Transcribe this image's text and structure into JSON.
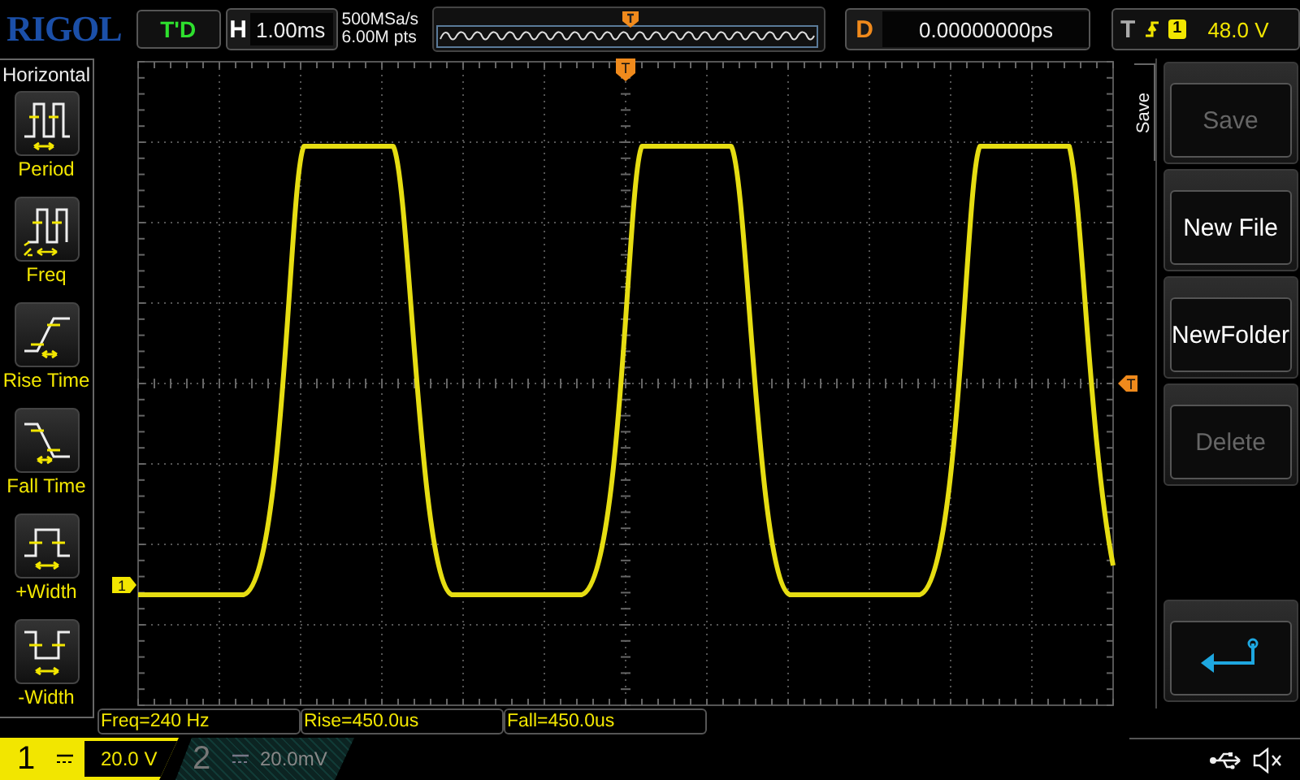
{
  "header": {
    "logo": "RIGOL",
    "run_status": "T'D",
    "timebase": {
      "label": "H",
      "value": "1.00ms"
    },
    "sample_rate": "500MSa/s",
    "memory_depth": "6.00M pts",
    "delay": {
      "label": "D",
      "value": "0.00000000ps"
    },
    "trigger": {
      "label": "T",
      "source": "1",
      "level": "48.0 V"
    }
  },
  "left_menu": {
    "title": "Horizontal",
    "items": [
      {
        "kind": "period",
        "label": "Period"
      },
      {
        "kind": "freq",
        "label": "Freq"
      },
      {
        "kind": "rise",
        "label": "Rise Time"
      },
      {
        "kind": "fall",
        "label": "Fall Time"
      },
      {
        "kind": "pwidth",
        "label": "+Width"
      },
      {
        "kind": "nwidth",
        "label": "-Width"
      }
    ]
  },
  "markers": {
    "trigger_position": "T",
    "trigger_level": "T",
    "channel": "1"
  },
  "right_menu": {
    "title": "Save",
    "buttons": [
      {
        "kind": "text",
        "label": "Save",
        "disabled": true
      },
      {
        "kind": "text",
        "label": "New File",
        "disabled": false
      },
      {
        "kind": "text",
        "label": "NewFolder",
        "disabled": false
      },
      {
        "kind": "text",
        "label": "Delete",
        "disabled": true
      },
      {
        "kind": "spacer"
      },
      {
        "kind": "back"
      }
    ]
  },
  "measurements": [
    "Freq=240 Hz",
    "Rise=450.0us",
    "Fall=450.0us"
  ],
  "channels": [
    {
      "number": "1",
      "scale": "20.0 V",
      "selected": true
    },
    {
      "number": "2",
      "scale": "20.0mV",
      "selected": false
    }
  ]
}
